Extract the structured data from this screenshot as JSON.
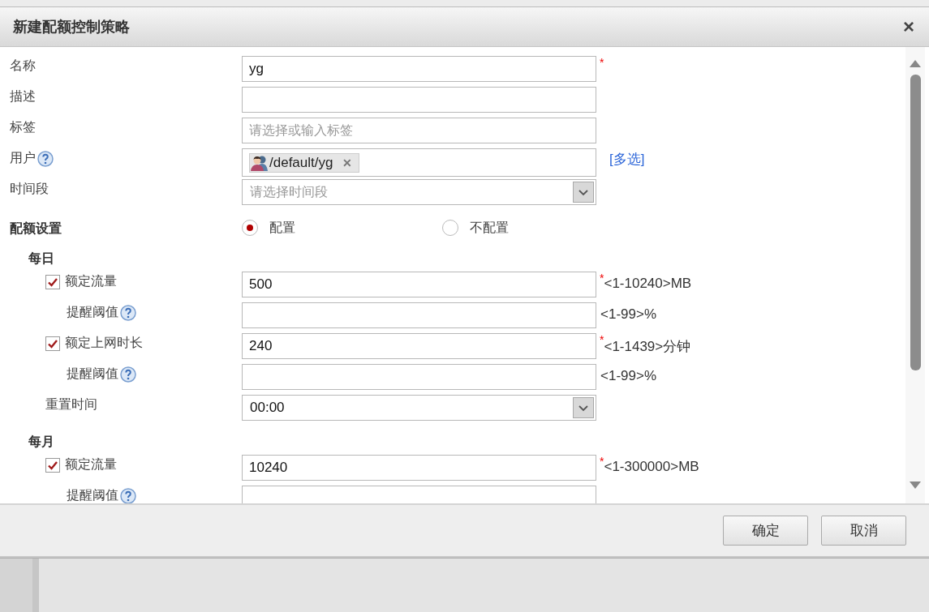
{
  "dialog": {
    "title": "新建配额控制策略",
    "close": "×"
  },
  "rows": [
    {
      "kind": "input",
      "label": "名称",
      "value": "yg",
      "mark": "*"
    },
    {
      "kind": "input",
      "label": "描述"
    },
    {
      "kind": "input",
      "label": "标签",
      "placeholder": "请选择或输入标签"
    },
    {
      "kind": "tags",
      "label": "用户",
      "help": true,
      "tags": [
        {
          "text": "/default/yg",
          "remove": "✕"
        }
      ],
      "link": "[多选]"
    },
    {
      "kind": "select",
      "label": "时间段",
      "placeholder": "请选择时间段"
    },
    {
      "kind": "radio",
      "label": "配额设置",
      "options": [
        {
          "label": "配置",
          "selected": true
        },
        {
          "label": "不配置",
          "selected": false
        }
      ]
    },
    {
      "kind": "group",
      "label": "每日"
    },
    {
      "kind": "check",
      "label": "额定流量",
      "checked": true,
      "value": "500",
      "mark": "*",
      "hint": "<1-10240>MB"
    },
    {
      "kind": "threshold",
      "label": "提醒阈值",
      "help": true,
      "hint": "<1-99>%"
    },
    {
      "kind": "check",
      "label": "额定上网时长",
      "checked": true,
      "value": "240",
      "mark": "*",
      "hint": "<1-1439>分钟"
    },
    {
      "kind": "threshold",
      "label": "提醒阈值",
      "help": true,
      "hint": "<1-99>%"
    },
    {
      "kind": "sub-select",
      "label": "重置时间",
      "value": "00:00"
    },
    {
      "kind": "group",
      "label": "每月"
    },
    {
      "kind": "check",
      "label": "额定流量",
      "checked": true,
      "value": "10240",
      "mark": "*",
      "hint": "<1-300000>MB"
    },
    {
      "kind": "threshold",
      "label": "提醒阈值",
      "help": true
    }
  ],
  "buttons": [
    "确定",
    "取消"
  ]
}
